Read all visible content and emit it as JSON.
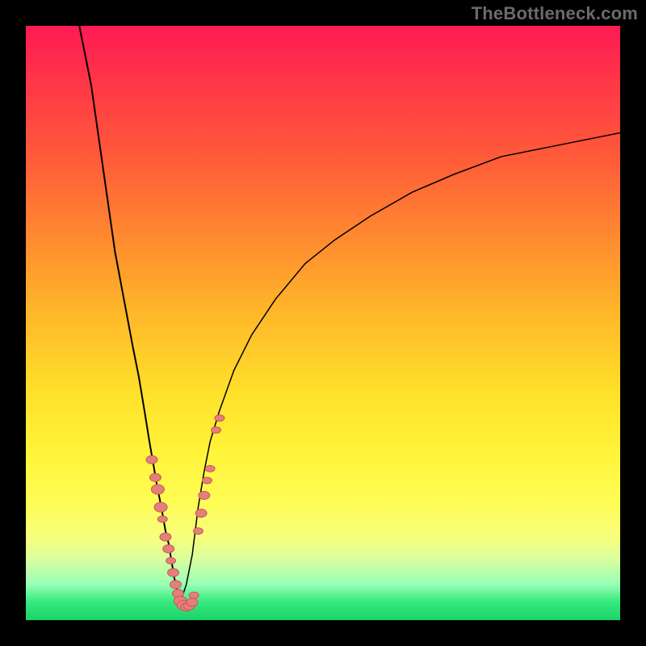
{
  "watermark": "TheBottleneck.com",
  "colors": {
    "frame": "#000000",
    "bead_fill": "#e57f7c",
    "bead_stroke": "#c85a56",
    "curve": "#000000"
  },
  "chart_data": {
    "type": "line",
    "title": "",
    "xlabel": "",
    "ylabel": "",
    "xlim": [
      0,
      100
    ],
    "ylim": [
      0,
      100
    ],
    "grid": false,
    "legend": false,
    "left_curve": {
      "x": [
        9,
        11,
        13,
        15,
        16.5,
        18,
        19,
        20,
        20.8,
        21.5,
        22,
        22.8,
        23.5,
        24,
        24.5,
        25,
        25.5,
        26
      ],
      "y": [
        100,
        90,
        76,
        62,
        54,
        46,
        41,
        35,
        30,
        26,
        23,
        19,
        15,
        13,
        10,
        7,
        5,
        3
      ]
    },
    "right_curve": {
      "x": [
        26,
        27,
        28,
        29,
        30,
        31,
        32.5,
        35,
        38,
        42,
        47,
        52,
        58,
        65,
        72,
        80,
        90,
        100
      ],
      "y": [
        3,
        6,
        11,
        19,
        25,
        30,
        35,
        42,
        48,
        54,
        60,
        64,
        68,
        72,
        75,
        78,
        80,
        82
      ]
    },
    "bead_points": [
      {
        "x": 21.2,
        "y": 27,
        "r": 5
      },
      {
        "x": 21.8,
        "y": 24,
        "r": 5
      },
      {
        "x": 22.2,
        "y": 22,
        "r": 6
      },
      {
        "x": 22.7,
        "y": 19,
        "r": 6
      },
      {
        "x": 23.0,
        "y": 17,
        "r": 4
      },
      {
        "x": 23.5,
        "y": 14,
        "r": 5
      },
      {
        "x": 24.0,
        "y": 12,
        "r": 5
      },
      {
        "x": 24.4,
        "y": 10,
        "r": 4
      },
      {
        "x": 24.8,
        "y": 8,
        "r": 5
      },
      {
        "x": 25.2,
        "y": 6,
        "r": 5
      },
      {
        "x": 25.6,
        "y": 4.5,
        "r": 5
      },
      {
        "x": 26.0,
        "y": 3.2,
        "r": 6
      },
      {
        "x": 26.5,
        "y": 2.5,
        "r": 6
      },
      {
        "x": 27.0,
        "y": 2.2,
        "r": 5
      },
      {
        "x": 27.5,
        "y": 2.4,
        "r": 5
      },
      {
        "x": 28.0,
        "y": 3.0,
        "r": 5
      },
      {
        "x": 28.3,
        "y": 4.2,
        "r": 4
      },
      {
        "x": 29.0,
        "y": 15,
        "r": 4
      },
      {
        "x": 29.5,
        "y": 18,
        "r": 5
      },
      {
        "x": 30.0,
        "y": 21,
        "r": 5
      },
      {
        "x": 30.5,
        "y": 23.5,
        "r": 4
      },
      {
        "x": 31.0,
        "y": 25.5,
        "r": 4
      },
      {
        "x": 32.0,
        "y": 32,
        "r": 4
      },
      {
        "x": 32.6,
        "y": 34,
        "r": 4
      }
    ]
  }
}
